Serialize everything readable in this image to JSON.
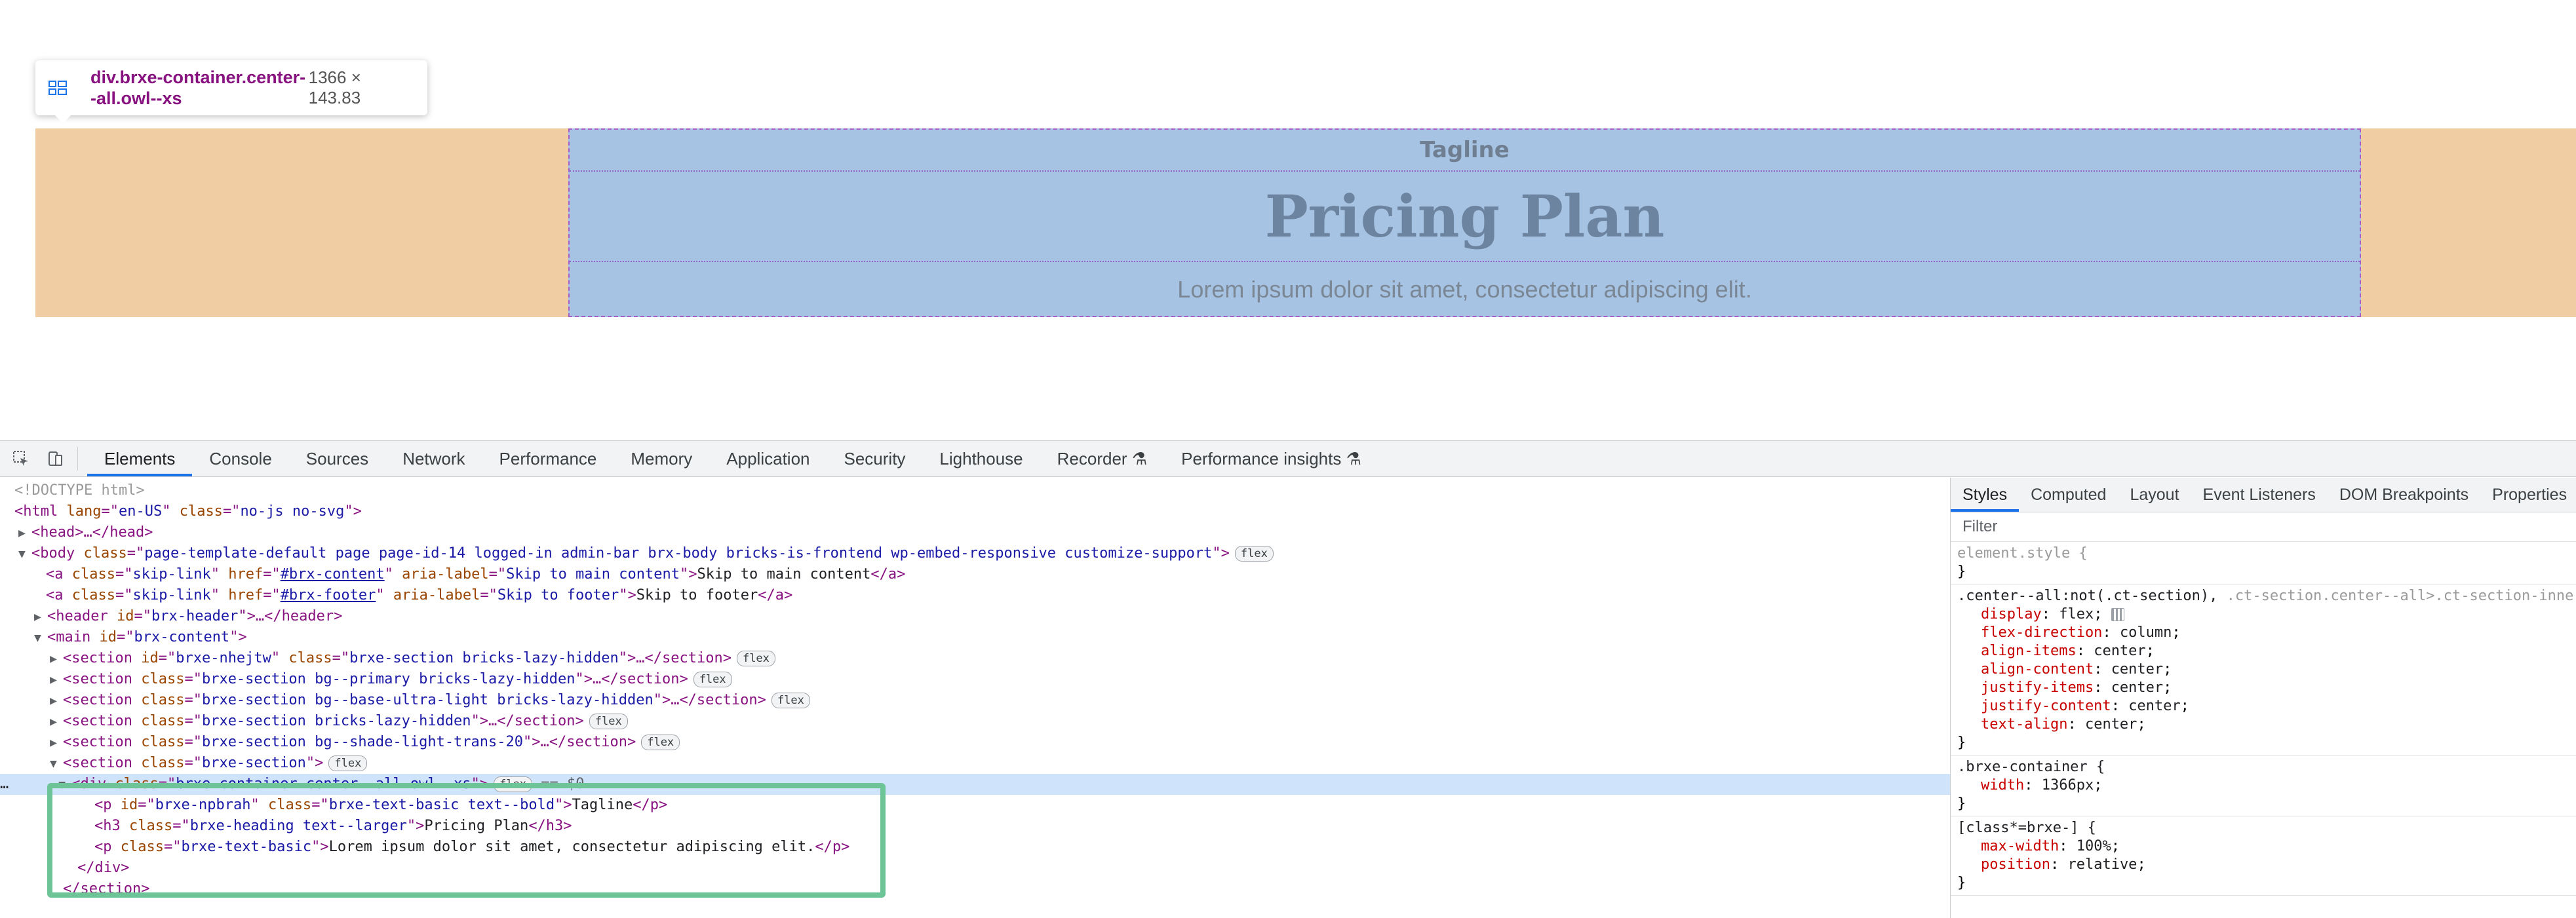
{
  "page": {
    "tagline": "Tagline",
    "title": "Pricing Plan",
    "description": "Lorem ipsum dolor sit amet, consectetur adipiscing elit."
  },
  "tooltip": {
    "selector": "div.brxe-container.center--all.owl--xs",
    "size": "1366 × 143.83",
    "icon": "grid-layout-icon"
  },
  "devtools": {
    "tabs": [
      "Elements",
      "Console",
      "Sources",
      "Network",
      "Performance",
      "Memory",
      "Application",
      "Security",
      "Lighthouse",
      "Recorder ⚗",
      "Performance insights ⚗"
    ],
    "active_tab": "Elements",
    "toolbar_icons": [
      "inspect-icon",
      "device-toggle-icon"
    ],
    "dom": {
      "doctype": "<!DOCTYPE html>",
      "html_tag": "html",
      "html_attrs": [
        [
          "lang",
          "en-US"
        ],
        [
          "class",
          "no-js no-svg"
        ]
      ],
      "head_collapsed": "<head>…</head>",
      "body_class": "page-template-default page page-id-14 logged-in admin-bar brx-body bricks-is-frontend wp-embed-responsive customize-support",
      "skip1": {
        "href": "#brx-content",
        "aria": "Skip to main content",
        "text": "Skip to main content"
      },
      "skip2": {
        "href": "#brx-footer",
        "aria": "Skip to footer",
        "text": "Skip to footer"
      },
      "header_id": "brx-header",
      "main_id": "brx-content",
      "sections": [
        {
          "id": "brxe-nhejtw",
          "class": "brxe-section bricks-lazy-hidden"
        },
        {
          "id": "",
          "class": "brxe-section bg--primary bricks-lazy-hidden"
        },
        {
          "id": "",
          "class": "brxe-section bg--base-ultra-light bricks-lazy-hidden"
        },
        {
          "id": "",
          "class": "brxe-section bricks-lazy-hidden"
        },
        {
          "id": "",
          "class": "brxe-section bg--shade-light-trans-20"
        }
      ],
      "open_section_class": "brxe-section",
      "div_class": "brxe-container center--all owl--xs",
      "div_ref": "== $0",
      "p1_id": "brxe-npbrah",
      "p1_class": "brxe-text-basic text--bold",
      "p1_text": "Tagline",
      "h3_class": "brxe-heading text--larger",
      "h3_text": "Pricing Plan",
      "p2_class": "brxe-text-basic",
      "p2_text": "Lorem ipsum dolor sit amet, consectetur adipiscing elit.",
      "badge": "flex",
      "ellipsis": "…"
    },
    "styles_tabs": [
      "Styles",
      "Computed",
      "Layout",
      "Event Listeners",
      "DOM Breakpoints",
      "Properties"
    ],
    "styles_active": "Styles",
    "filter_placeholder": "Filter",
    "rules": {
      "element_style": "element.style {",
      "r1_selector": ".center--all:not(.ct-section),",
      "r1_selector_dim": ".ct-section.center--all>.ct-section-inner",
      "r1_props": [
        [
          "display",
          "flex"
        ],
        [
          "flex-direction",
          "column"
        ],
        [
          "align-items",
          "center"
        ],
        [
          "align-content",
          "center"
        ],
        [
          "justify-items",
          "center"
        ],
        [
          "justify-content",
          "center"
        ],
        [
          "text-align",
          "center"
        ]
      ],
      "r2_selector": ".brxe-container {",
      "r2_props": [
        [
          "width",
          "1366px"
        ]
      ],
      "r3_selector": "[class*=brxe-] {",
      "r3_props": [
        [
          "max-width",
          "100%"
        ],
        [
          "position",
          "relative"
        ]
      ],
      "close": "}"
    },
    "colors": {
      "highlight_green": "#6cc497",
      "selected_row": "#cfe3fb",
      "accent_blue": "#1a73e8"
    }
  }
}
